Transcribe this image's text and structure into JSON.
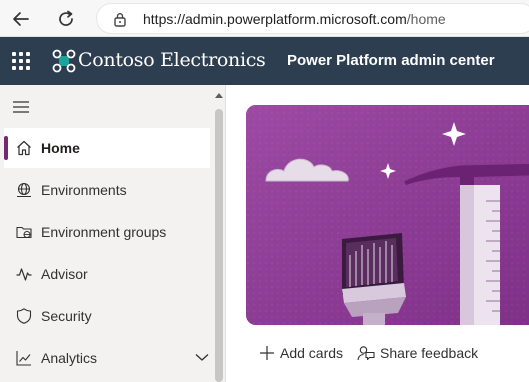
{
  "browser": {
    "url_host": "https://admin.powerplatform.microsoft.com",
    "url_path": "/home"
  },
  "header": {
    "brand": "Contoso Electronics",
    "title": "Power Platform admin center"
  },
  "sidebar": {
    "items": [
      {
        "label": "Home",
        "icon": "home-icon"
      },
      {
        "label": "Environments",
        "icon": "environments-icon"
      },
      {
        "label": "Environment groups",
        "icon": "environment-groups-icon"
      },
      {
        "label": "Advisor",
        "icon": "advisor-icon"
      },
      {
        "label": "Security",
        "icon": "shield-icon"
      },
      {
        "label": "Analytics",
        "icon": "analytics-icon"
      }
    ],
    "active_index": 0
  },
  "actions": {
    "add_cards": "Add cards",
    "share_feedback": "Share feedback"
  },
  "colors": {
    "header_bg": "#2c3e50",
    "accent": "#742774",
    "hero_bg": "#8b3a91"
  }
}
